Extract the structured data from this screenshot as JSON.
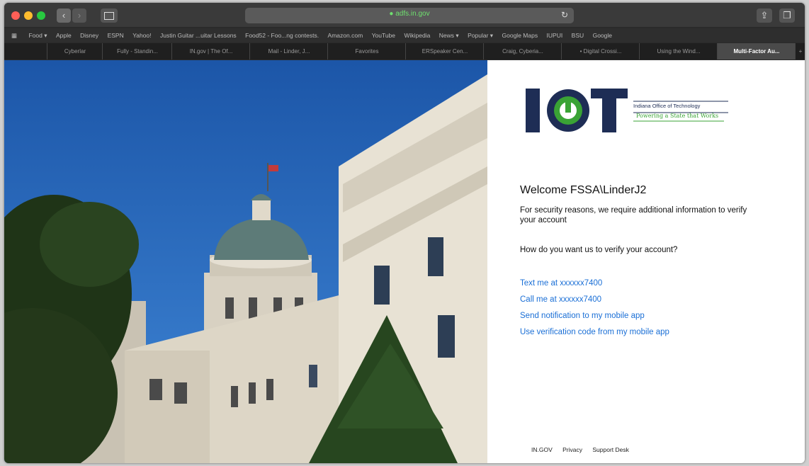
{
  "browser": {
    "address": "● adfs.in.gov",
    "favorites": [
      "Food ▾",
      "Apple",
      "Disney",
      "ESPN",
      "Yahoo!",
      "Justin Guitar ...uitar Lessons",
      "Food52 - Foo...ng contests.",
      "Amazon.com",
      "YouTube",
      "Wikipedia",
      "News ▾",
      "Popular ▾",
      "Google Maps",
      "IUPUI",
      "BSU",
      "Google"
    ],
    "tabs": [
      "Cyberlar",
      "Fully - Standin...",
      "IN.gov | The Of...",
      "Mail - Linder, J...",
      "Favorites",
      "ERSpeaker Cen...",
      "Craig, Cyberia...",
      "• Digital Crossi...",
      "Using the Wind...",
      "Multi-Factor Au..."
    ]
  },
  "logo": {
    "letters": "IOT",
    "line1": "Indiana Office of Technology",
    "line2": "Powering a State that Works"
  },
  "login": {
    "welcome": "Welcome FSSA\\LinderJ2",
    "info": "For security reasons, we require additional information to verify your account",
    "question": "How do you want us to verify your account?",
    "options": [
      "Text me at xxxxxx7400",
      "Call me at xxxxxx7400",
      "Send notification to my mobile app",
      "Use verification code from my mobile app"
    ]
  },
  "footer": [
    "IN.GOV",
    "Privacy",
    "Support Desk"
  ],
  "colors": {
    "link": "#1a6fd6",
    "logo_navy": "#1e2d55",
    "logo_green": "#3aa335",
    "sky": "#1a5fb0"
  }
}
